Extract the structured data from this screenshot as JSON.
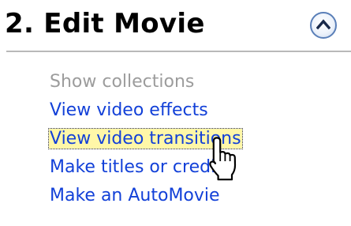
{
  "section": {
    "title": "2. Edit Movie",
    "collapse_icon": "chevron-up-icon"
  },
  "tasks": [
    {
      "label": "Show collections",
      "state": "disabled"
    },
    {
      "label": "View video effects",
      "state": "normal"
    },
    {
      "label": "View video transitions",
      "state": "hovered"
    },
    {
      "label": "Make titles or credits",
      "state": "normal"
    },
    {
      "label": "Make an AutoMovie",
      "state": "normal"
    }
  ],
  "cursor": {
    "icon": "hand-pointer-cursor-icon"
  },
  "colors": {
    "link": "#1240d8",
    "disabled": "#9c9c9c",
    "hover_highlight": "#fff7a8",
    "button_border": "#5a7fb8",
    "divider": "#b9b9b9"
  }
}
